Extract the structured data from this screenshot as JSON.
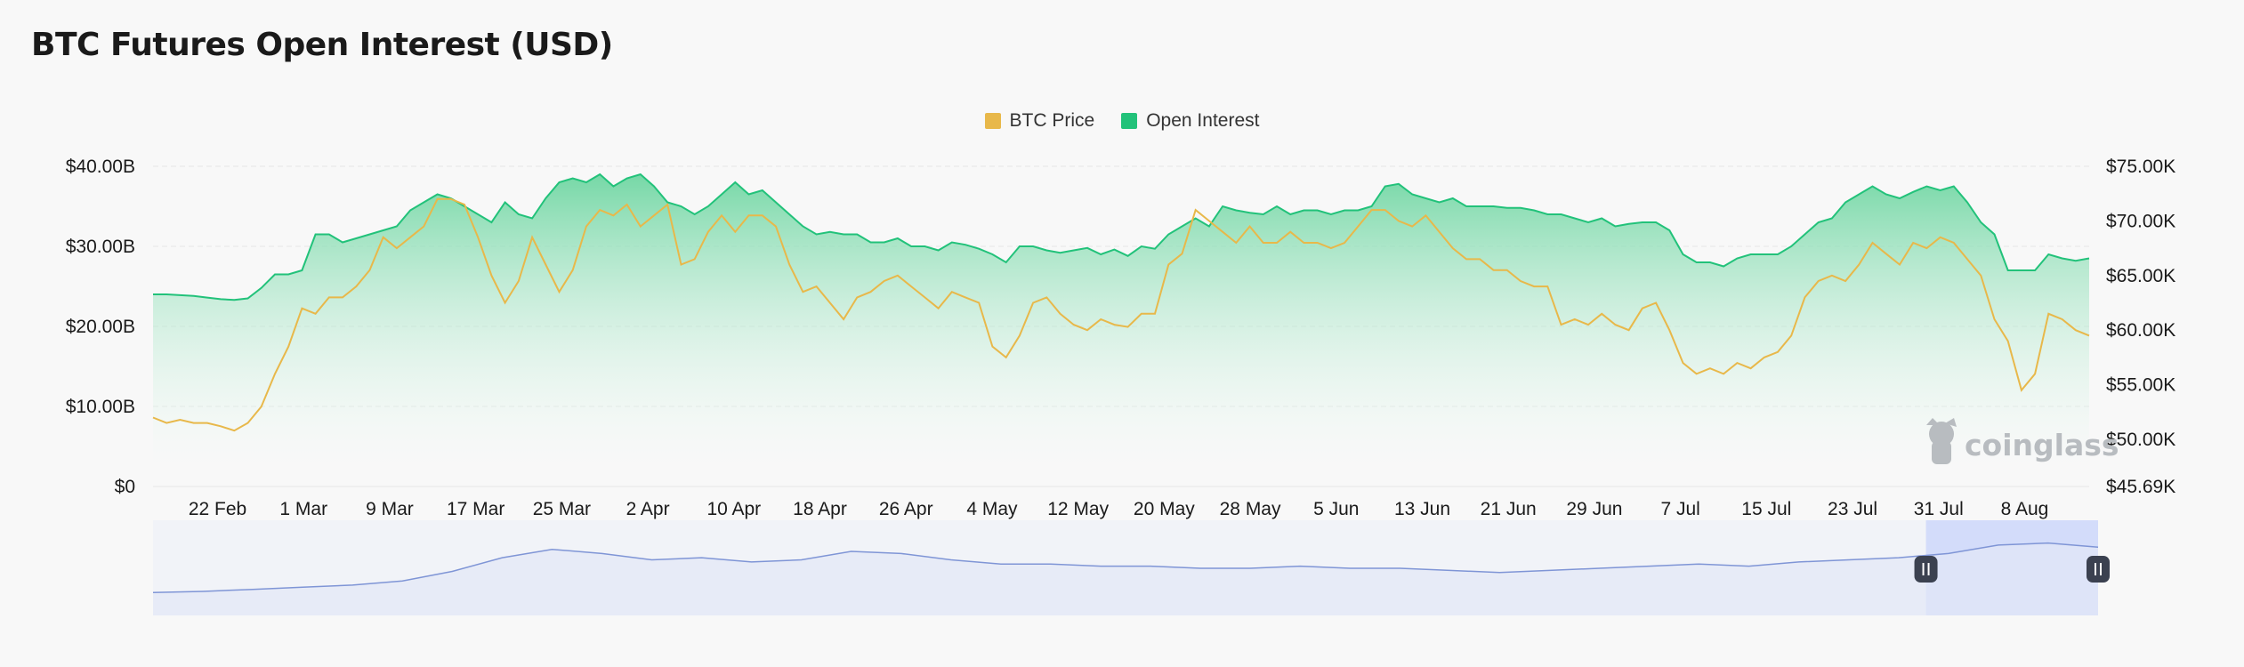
{
  "title": "BTC Futures Open Interest (USD)",
  "watermark": "coinglass",
  "colors": {
    "btc_price": "#e8b84a",
    "open_interest": "#22c27a",
    "open_interest_fill_top": "#6fd6a2",
    "navigator_line": "#7f95d6",
    "navigator_fill": "#e2e7f6",
    "navigator_selection": "#d3dcfa",
    "grid": "#ececec"
  },
  "legend": [
    {
      "label": "BTC Price",
      "icon": "legend-square-yellow"
    },
    {
      "label": "Open Interest",
      "icon": "legend-square-green"
    }
  ],
  "navigator": {
    "selection_start": "2024-07-25",
    "selection_end": "2024-08-14"
  },
  "chart_data": {
    "type": "area",
    "title": "BTC Futures Open Interest (USD)",
    "x_start": "2024-02-16",
    "x_end": "2024-08-14",
    "x_tick_labels": [
      "22 Feb",
      "1 Mar",
      "9 Mar",
      "17 Mar",
      "25 Mar",
      "2 Apr",
      "10 Apr",
      "18 Apr",
      "26 Apr",
      "4 May",
      "12 May",
      "20 May",
      "28 May",
      "5 Jun",
      "13 Jun",
      "21 Jun",
      "29 Jun",
      "7 Jul",
      "15 Jul",
      "23 Jul",
      "31 Jul",
      "8 Aug"
    ],
    "y_left": {
      "tick_labels": [
        "$0",
        "$10.00B",
        "$20.00B",
        "$30.00B",
        "$40.00B"
      ],
      "min": 0,
      "max": 40,
      "unit": "B USD"
    },
    "y_right": {
      "tick_labels": [
        "$45.69K",
        "$50.00K",
        "$55.00K",
        "$60.00K",
        "$65.00K",
        "$70.00K",
        "$75.00K"
      ],
      "min": 45.69,
      "max": 75,
      "unit": "K USD"
    },
    "grid": true,
    "legend_position": "top-center",
    "series": [
      {
        "name": "Open Interest",
        "axis": "left",
        "type": "area",
        "values": [
          24.0,
          24.0,
          23.9,
          23.8,
          23.6,
          23.4,
          23.3,
          23.5,
          24.8,
          26.5,
          26.5,
          27.0,
          31.5,
          31.5,
          30.5,
          31.0,
          31.5,
          32.0,
          32.5,
          34.5,
          35.5,
          36.5,
          36.0,
          35.0,
          34.0,
          33.0,
          35.5,
          34.0,
          33.5,
          36.0,
          38.0,
          38.5,
          38.0,
          39.0,
          37.5,
          38.5,
          39.0,
          37.5,
          35.5,
          35.0,
          34.0,
          35.0,
          36.5,
          38.0,
          36.5,
          37.0,
          35.5,
          34.0,
          32.5,
          31.5,
          31.8,
          31.5,
          31.5,
          30.5,
          30.5,
          31.0,
          30.0,
          30.0,
          29.5,
          30.5,
          30.2,
          29.7,
          29.0,
          28.0,
          30.0,
          30.0,
          29.5,
          29.2,
          29.5,
          29.8,
          29.0,
          29.6,
          28.8,
          30.0,
          29.7,
          31.5,
          32.5,
          33.5,
          32.5,
          35.0,
          34.5,
          34.2,
          34.0,
          35.0,
          34.0,
          34.5,
          34.5,
          34.0,
          34.5,
          34.5,
          35.0,
          37.5,
          37.8,
          36.5,
          36.0,
          35.5,
          36.0,
          35.0,
          35.0,
          35.0,
          34.8,
          34.8,
          34.5,
          34.0,
          34.0,
          33.5,
          33.0,
          33.5,
          32.5,
          32.8,
          33.0,
          33.0,
          32.0,
          29.0,
          28.0,
          28.0,
          27.5,
          28.5,
          29.0,
          29.0,
          29.0,
          30.0,
          31.5,
          33.0,
          33.5,
          35.5,
          36.5,
          37.5,
          36.5,
          36.0,
          36.8,
          37.5,
          37.0,
          37.5,
          35.5,
          33.0,
          31.5,
          27.0,
          27.0,
          27.0,
          29.0,
          28.5,
          28.2,
          28.5
        ]
      },
      {
        "name": "BTC Price",
        "axis": "right",
        "type": "line",
        "values": [
          52.0,
          51.5,
          51.8,
          51.5,
          51.5,
          51.2,
          50.8,
          51.5,
          53.0,
          56.0,
          58.5,
          62.0,
          61.5,
          63.0,
          63.0,
          64.0,
          65.5,
          68.5,
          67.5,
          68.5,
          69.5,
          72.0,
          72.0,
          71.5,
          68.5,
          65.0,
          62.5,
          64.5,
          68.5,
          66.0,
          63.5,
          65.5,
          69.5,
          71.0,
          70.5,
          71.5,
          69.5,
          70.5,
          71.5,
          66.0,
          66.5,
          69.0,
          70.5,
          69.0,
          70.5,
          70.5,
          69.5,
          66.0,
          63.5,
          64.0,
          62.5,
          61.0,
          63.0,
          63.5,
          64.5,
          65.0,
          64.0,
          63.0,
          62.0,
          63.5,
          63.0,
          62.5,
          58.5,
          57.5,
          59.5,
          62.5,
          63.0,
          61.5,
          60.5,
          60.0,
          61.0,
          60.5,
          60.3,
          61.5,
          61.5,
          66.0,
          67.0,
          71.0,
          70.0,
          69.0,
          68.0,
          69.5,
          68.0,
          68.0,
          69.0,
          68.0,
          68.0,
          67.5,
          68.0,
          69.5,
          71.0,
          71.0,
          70.0,
          69.5,
          70.5,
          69.0,
          67.5,
          66.5,
          66.5,
          65.5,
          65.5,
          64.5,
          64.0,
          64.0,
          60.5,
          61.0,
          60.5,
          61.5,
          60.5,
          60.0,
          62.0,
          62.5,
          60.0,
          57.0,
          56.0,
          56.5,
          56.0,
          57.0,
          56.5,
          57.5,
          58.0,
          59.5,
          63.0,
          64.5,
          65.0,
          64.5,
          66.0,
          68.0,
          67.0,
          66.0,
          68.0,
          67.5,
          68.5,
          68.0,
          66.5,
          65.0,
          61.0,
          59.0,
          54.5,
          56.0,
          61.5,
          61.0,
          60.0,
          59.5
        ]
      }
    ],
    "navigator_series": [
      1.5,
      1.6,
      1.8,
      2.0,
      2.2,
      2.6,
      3.5,
      4.8,
      5.6,
      5.2,
      4.6,
      4.8,
      4.4,
      4.6,
      5.4,
      5.2,
      4.6,
      4.2,
      4.2,
      4.0,
      4.0,
      3.8,
      3.8,
      4.0,
      3.8,
      3.8,
      3.6,
      3.4,
      3.6,
      3.8,
      4.0,
      4.2,
      4.0,
      4.4,
      4.6,
      4.8,
      5.2,
      6.0,
      6.2,
      5.8
    ]
  }
}
